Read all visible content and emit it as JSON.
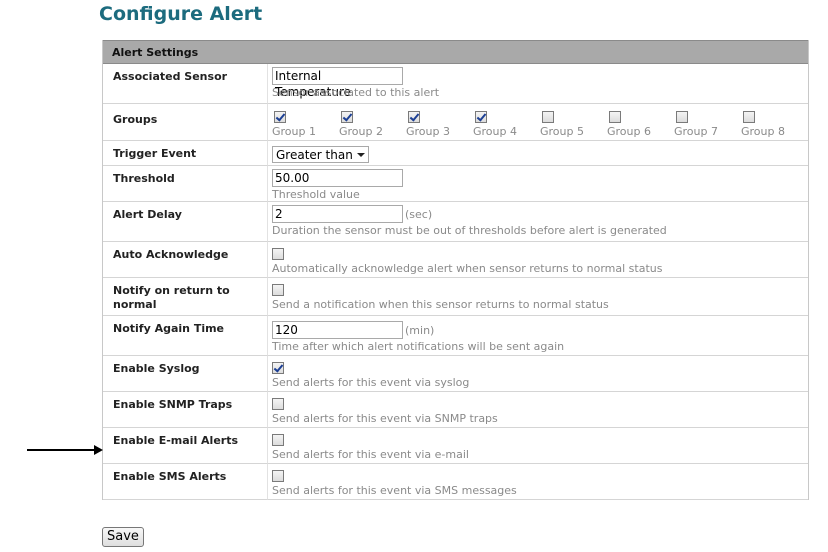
{
  "page": {
    "title": "Configure Alert"
  },
  "section": {
    "title": "Alert Settings"
  },
  "rows": {
    "associated_sensor": {
      "label": "Associated Sensor",
      "value": "Internal Temperature",
      "hint": "Sensor associated to this alert"
    },
    "groups": {
      "label": "Groups",
      "items": [
        {
          "label": "Group 1",
          "checked": true
        },
        {
          "label": "Group 2",
          "checked": true
        },
        {
          "label": "Group 3",
          "checked": true
        },
        {
          "label": "Group 4",
          "checked": true
        },
        {
          "label": "Group 5",
          "checked": false
        },
        {
          "label": "Group 6",
          "checked": false
        },
        {
          "label": "Group 7",
          "checked": false
        },
        {
          "label": "Group 8",
          "checked": false
        }
      ]
    },
    "trigger_event": {
      "label": "Trigger Event",
      "value": "Greater than"
    },
    "threshold": {
      "label": "Threshold",
      "value": "50.00",
      "hint": "Threshold value"
    },
    "alert_delay": {
      "label": "Alert Delay",
      "value": "2",
      "unit": "(sec)",
      "hint": "Duration the sensor must be out of thresholds before alert is generated"
    },
    "auto_acknowledge": {
      "label": "Auto Acknowledge",
      "checked": false,
      "hint": "Automatically acknowledge alert when sensor returns to normal status"
    },
    "notify_return": {
      "label": "Notify on return to normal",
      "checked": false,
      "hint": "Send a notification when this sensor returns to normal status"
    },
    "notify_again": {
      "label": "Notify Again Time",
      "value": "120",
      "unit": "(min)",
      "hint": "Time after which alert notifications will be sent again"
    },
    "syslog": {
      "label": "Enable Syslog",
      "checked": true,
      "hint": "Send alerts for this event via syslog"
    },
    "snmp": {
      "label": "Enable SNMP Traps",
      "checked": false,
      "hint": "Send alerts for this event via SNMP traps"
    },
    "email": {
      "label": "Enable E-mail Alerts",
      "checked": false,
      "hint": "Send alerts for this event via e-mail"
    },
    "sms": {
      "label": "Enable SMS Alerts",
      "checked": false,
      "hint": "Send alerts for this event via SMS messages"
    }
  },
  "actions": {
    "save_label": "Save"
  },
  "colors": {
    "title": "#1c6b7e",
    "header_bg": "#a9a9a9",
    "hint": "#8a8a8a"
  },
  "annotation": {
    "icon": "arrow-right-icon"
  }
}
